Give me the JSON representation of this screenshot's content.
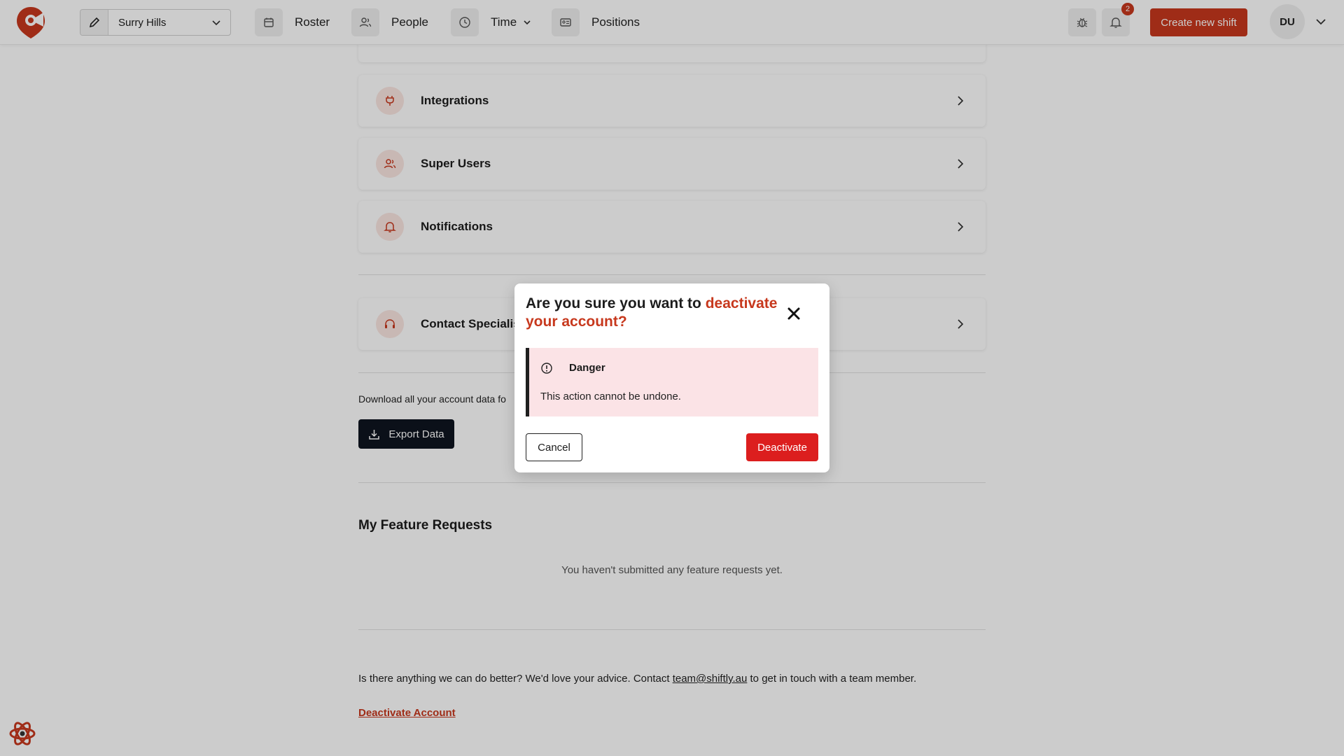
{
  "nav": {
    "location": "Surry Hills",
    "items": [
      {
        "label": "Roster"
      },
      {
        "label": "People"
      },
      {
        "label": "Time"
      },
      {
        "label": "Positions"
      }
    ],
    "notification_count": "2",
    "create_shift_label": "Create new shift",
    "avatar_initials": "DU"
  },
  "settings": {
    "items": [
      {
        "label": "Integrations",
        "icon": "plug-icon"
      },
      {
        "label": "Super Users",
        "icon": "users-icon"
      },
      {
        "label": "Notifications",
        "icon": "bell-icon"
      },
      {
        "label": "Contact Specialist",
        "icon": "headphones-icon"
      }
    ]
  },
  "export": {
    "description": "Download all your account data fo",
    "button_label": "Export Data"
  },
  "feature_requests": {
    "heading": "My Feature Requests",
    "empty_text": "You haven't submitted any feature requests yet."
  },
  "advice": {
    "before": "Is there anything we can do better? We'd love your advice. Contact ",
    "email": "team@shiftly.au",
    "after": " to get in touch with a team member."
  },
  "deactivate_link": "Deactivate Account",
  "modal": {
    "title_prefix": "Are you sure you want to ",
    "title_accent": "deactivate your account?",
    "alert_title": "Danger",
    "alert_text": "This action cannot be undone.",
    "cancel_label": "Cancel",
    "confirm_label": "Deactivate"
  },
  "colors": {
    "brand": "#c7381d",
    "danger": "#dc1e1e",
    "alert_bg": "#fbe3e6",
    "dark_button": "#0e1420"
  }
}
